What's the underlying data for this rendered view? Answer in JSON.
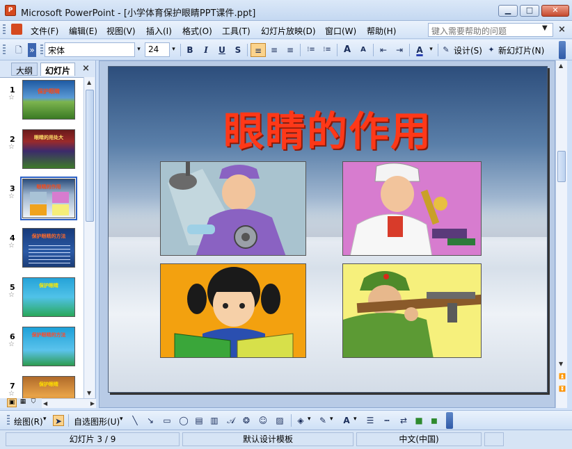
{
  "window": {
    "app_icon_text": "P",
    "title": "Microsoft PowerPoint - [小学体育保护眼睛PPT课件.ppt]",
    "minimize": "▁",
    "maximize": "□",
    "close": "✕"
  },
  "menubar": {
    "items": [
      "文件(F)",
      "编辑(E)",
      "视图(V)",
      "插入(I)",
      "格式(O)",
      "工具(T)",
      "幻灯片放映(D)",
      "窗口(W)",
      "帮助(H)"
    ],
    "help_placeholder": "键入需要帮助的问题",
    "help_dropdown": "▼",
    "doc_close": "×"
  },
  "toolbar": {
    "font_name": "宋体",
    "font_size": "24",
    "bold": "B",
    "italic": "I",
    "underline": "U",
    "shadow": "S",
    "align_left": "≡",
    "align_center": "≡",
    "align_right": "≡",
    "numbering": "⁝≡",
    "bullets": "⁝≡",
    "grow": "A",
    "shrink": "A",
    "decrease_indent": "⇤",
    "increase_indent": "⇥",
    "font_color": "A",
    "design_label": "设计(S)",
    "new_slide_label": "新幻灯片(N)",
    "dropdown_arrow": "▾",
    "more": "»"
  },
  "left_panel": {
    "tab_outline": "大纲",
    "tab_slides": "幻灯片",
    "close": "×",
    "slides": [
      {
        "num": "1",
        "title": "保护眼睛"
      },
      {
        "num": "2",
        "title": "眼睛的用处大"
      },
      {
        "num": "3",
        "title": "眼睛的作用"
      },
      {
        "num": "4",
        "title": "保护眼睛的方法"
      },
      {
        "num": "5",
        "title": "保护眼睛"
      },
      {
        "num": "6",
        "title": "保护眼睛的方法"
      },
      {
        "num": "7",
        "title": "保护眼睛"
      }
    ],
    "star": "☆"
  },
  "slide": {
    "title": "眼睛的作用"
  },
  "drawbar": {
    "draw_label": "绘图(R)",
    "autoshapes_label": "自选图形(U)",
    "dropdown": "▾"
  },
  "status": {
    "slide_info": "幻灯片 3 / 9",
    "template": "默认设计模板",
    "language": "中文(中国)"
  },
  "colors": {
    "accent": "#ff3818",
    "titlebar": "#c4d8f1"
  }
}
